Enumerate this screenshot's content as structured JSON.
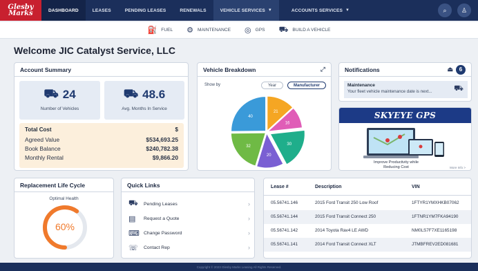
{
  "nav": {
    "logo": "Glesby Marks",
    "items": [
      "DASHBOARD",
      "LEASES",
      "PENDING LEASES",
      "RENEWALS"
    ],
    "vehicle_services": "VEHICLE SERVICES",
    "accounts_services": "ACCOUNTS SERVICES"
  },
  "subnav": {
    "items": [
      "FUEL",
      "MAINTENANCE",
      "GPS",
      "BUILD A VEHICLE"
    ]
  },
  "welcome": "Welcome JIC Catalyst Service, LLC",
  "account_summary": {
    "title": "Account Summary",
    "vehicles": "24",
    "vehicles_label": "Number of Vehicles",
    "months": "48.6",
    "months_label": "Avg. Months In Service",
    "total_cost_label": "Total Cost",
    "rows": [
      {
        "label": "Agreed Value",
        "value": "$534,693.25"
      },
      {
        "label": "Book Balance",
        "value": "$240,782.38"
      },
      {
        "label": "Monthly Rental",
        "value": "$9,866.20"
      }
    ]
  },
  "vehicle_breakdown": {
    "title": "Vehicle Breakdown",
    "show_by": "Show by",
    "year": "Year",
    "manufacturer": "Manufacturer"
  },
  "chart_data": {
    "type": "pie",
    "values": [
      21,
      16,
      30,
      20,
      32,
      40
    ],
    "colors": [
      "#f5a623",
      "#e05db7",
      "#1fae8b",
      "#7a5fd3",
      "#6fba45",
      "#3a9ad9"
    ]
  },
  "notifications": {
    "title": "Notifications",
    "count": "6",
    "item_title": "Maintenance",
    "item_desc": "Your fleet vehicle maintenance date is next..."
  },
  "ad": {
    "title": "SKYEYE GPS",
    "caption_1": "Improve Productivity while",
    "caption_2": "Reducing Cost",
    "more": "More Info >"
  },
  "replacement": {
    "title": "Replacement Life Cycle",
    "subtitle": "Optimal Health",
    "percent": "60%",
    "value": 0.6
  },
  "quick_links": {
    "title": "Quick Links",
    "items": [
      "Pending Leases",
      "Request a Quote",
      "Change Password",
      "Contact Rep"
    ]
  },
  "lease_table": {
    "headers": [
      "Lease #",
      "Description",
      "VIN"
    ],
    "rows": [
      [
        "05.56741.146",
        "2015 Ford Transit 250 Low Roof",
        "1FTYR1YMXHKB07062"
      ],
      [
        "05.56741.144",
        "2015 Ford Transit Connect 250",
        "1FTNR1YM7FKA94190"
      ],
      [
        "05.56741.142",
        "2014 Toyota Rav4 LE AWD",
        "NM0LS7F7XE1165198"
      ],
      [
        "05.56741.141",
        "2014 Ford Transit Connect XLT",
        "JTMBFREV2ED081681"
      ]
    ]
  },
  "footer": "Copyright © 2023 Glesby Marks Leasing All Rights Reserved."
}
